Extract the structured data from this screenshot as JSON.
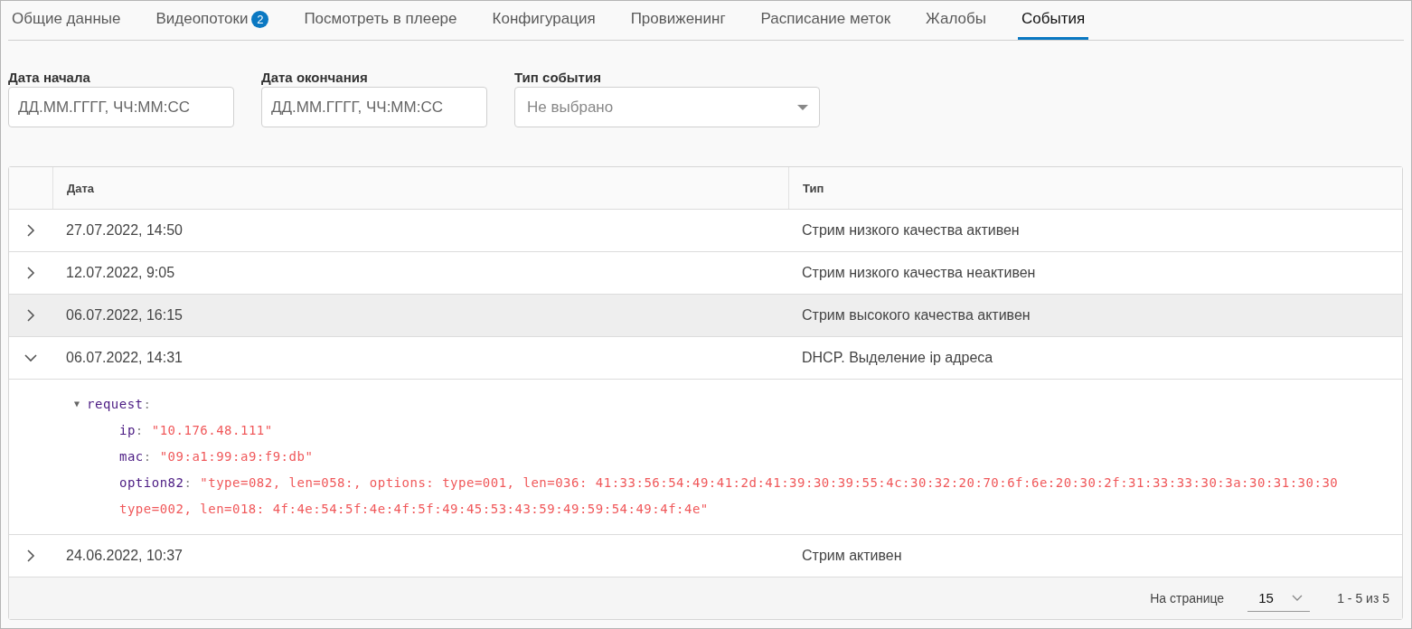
{
  "tabs": [
    {
      "label": "Общие данные",
      "selected": false
    },
    {
      "label": "Видеопотоки",
      "badge": "2",
      "selected": false
    },
    {
      "label": "Посмотреть в плеере",
      "selected": false
    },
    {
      "label": "Конфигурация",
      "selected": false
    },
    {
      "label": "Провиженинг",
      "selected": false
    },
    {
      "label": "Расписание меток",
      "selected": false
    },
    {
      "label": "Жалобы",
      "selected": false
    },
    {
      "label": "События",
      "selected": true
    }
  ],
  "filters": [
    {
      "kind": "text",
      "label": "Дата начала",
      "placeholder": "ДД.ММ.ГГГГ, ЧЧ:ММ:СС"
    },
    {
      "kind": "text",
      "label": "Дата окончания",
      "placeholder": "ДД.ММ.ГГГГ, ЧЧ:ММ:СС"
    },
    {
      "kind": "select",
      "label": "Тип события",
      "placeholder": "Не выбрано"
    }
  ],
  "table": {
    "columns": [
      "Дата",
      "Тип"
    ],
    "rows": [
      {
        "date": "27.07.2022, 14:50",
        "type": "Стрим низкого качества активен",
        "expanded": false,
        "selected": false
      },
      {
        "date": "12.07.2022, 9:05",
        "type": "Стрим низкого качества неактивен",
        "expanded": false,
        "selected": false
      },
      {
        "date": "06.07.2022, 16:15",
        "type": "Стрим высокого качества активен",
        "expanded": false,
        "selected": true
      },
      {
        "date": "06.07.2022, 14:31",
        "type": "DHCP. Выделение ip адреса",
        "expanded": true,
        "selected": false,
        "details": {
          "toggle": "▼",
          "key": "request",
          "separator": ":",
          "expanded": true,
          "fields": [
            {
              "key": "ip",
              "separator": ":",
              "lines": [
                "\"10.176.48.111\""
              ]
            },
            {
              "key": "mac",
              "separator": ":",
              "lines": [
                "\"09:a1:99:a9:f9:db\""
              ]
            },
            {
              "key": "option82",
              "separator": ":",
              "lines": [
                "\"type=082, len=058:, options: type=001, len=036: 41:33:56:54:49:41:2d:41:39:30:39:55:4c:30:32:20:70:6f:6e:20:30:2f:31:33:33:30:3a:30:31:30:30",
                "type=002, len=018: 4f:4e:54:5f:4e:4f:5f:49:45:53:43:59:49:59:54:49:4f:4e\""
              ]
            }
          ]
        }
      },
      {
        "date": "24.06.2022, 10:37",
        "type": "Стрим активен",
        "expanded": false,
        "selected": false
      }
    ]
  },
  "pagination": {
    "label": "На странице",
    "page_size": "15",
    "range": "1 - 5 из 5"
  }
}
